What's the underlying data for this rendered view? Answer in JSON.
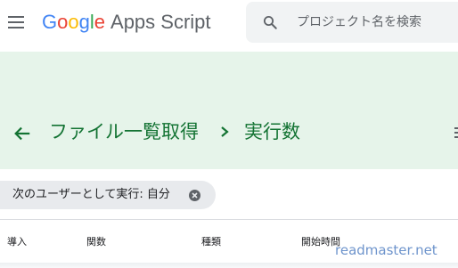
{
  "topbar": {
    "logo": {
      "letters": [
        "G",
        "o",
        "o",
        "g",
        "l",
        "e"
      ],
      "product": "Apps Script",
      "colors": {
        "blue": "#4285f4",
        "red": "#ea4335",
        "yellow": "#fbbc05",
        "green": "#34a853"
      }
    },
    "menu_icon": "hamburger-menu-icon",
    "search": {
      "icon": "search-icon",
      "placeholder": "プロジェクト名を検索"
    }
  },
  "page_header": {
    "back_icon": "arrow-left-icon",
    "breadcrumb": [
      {
        "label": "ファイル一覧取得"
      },
      {
        "label": "実行数"
      }
    ],
    "separator_icon": "chevron-right-icon",
    "band_color": "#e6f4ea",
    "text_color": "#137333"
  },
  "filter": {
    "chip_label": "次のユーザーとして実行: 自分",
    "remove_icon": "cancel-circle-icon"
  },
  "table": {
    "columns": [
      "導入",
      "関数",
      "種類",
      "開始時間"
    ]
  },
  "watermark": "readmaster.net"
}
